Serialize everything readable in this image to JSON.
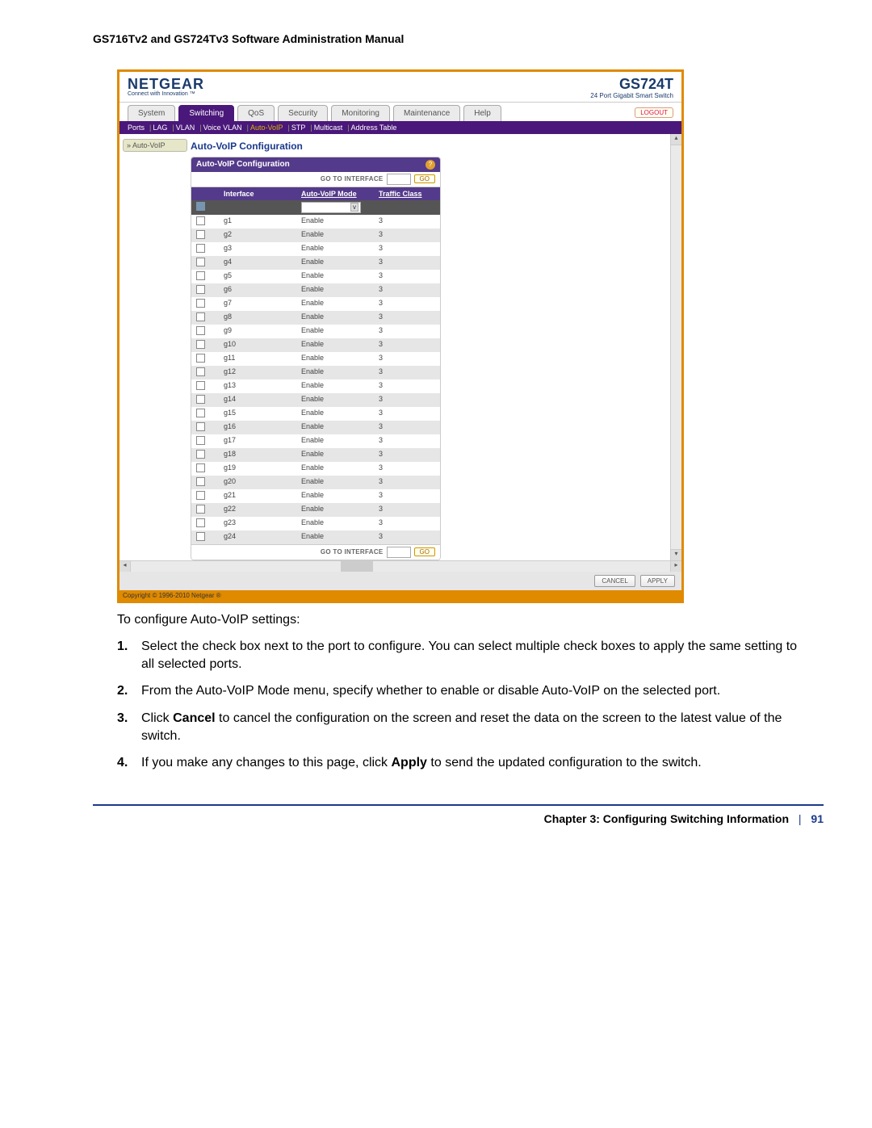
{
  "doc_title": "GS716Tv2 and GS724Tv3 Software Administration Manual",
  "header": {
    "logo": "NETGEAR",
    "logo_sub": "Connect with Innovation ™",
    "model": "GS724T",
    "model_sub": "24 Port Gigabit Smart Switch"
  },
  "tabs": {
    "items": [
      "System",
      "Switching",
      "QoS",
      "Security",
      "Monitoring",
      "Maintenance",
      "Help"
    ],
    "active_index": 1,
    "logout": "LOGOUT"
  },
  "subtabs": {
    "items": [
      "Ports",
      "LAG",
      "VLAN",
      "Voice VLAN",
      "Auto-VoIP",
      "STP",
      "Multicast",
      "Address Table"
    ],
    "active_index": 4
  },
  "side_button": "» Auto-VoIP",
  "section_title": "Auto-VoIP Configuration",
  "panel": {
    "title": "Auto-VoIP Configuration",
    "goto_label": "GO TO INTERFACE",
    "go_btn": "GO",
    "columns": {
      "interface": "Interface",
      "mode": "Auto-VoIP Mode",
      "tc": "Traffic Class"
    },
    "rows": [
      {
        "if": "g1",
        "mode": "Enable",
        "tc": "3"
      },
      {
        "if": "g2",
        "mode": "Enable",
        "tc": "3"
      },
      {
        "if": "g3",
        "mode": "Enable",
        "tc": "3"
      },
      {
        "if": "g4",
        "mode": "Enable",
        "tc": "3"
      },
      {
        "if": "g5",
        "mode": "Enable",
        "tc": "3"
      },
      {
        "if": "g6",
        "mode": "Enable",
        "tc": "3"
      },
      {
        "if": "g7",
        "mode": "Enable",
        "tc": "3"
      },
      {
        "if": "g8",
        "mode": "Enable",
        "tc": "3"
      },
      {
        "if": "g9",
        "mode": "Enable",
        "tc": "3"
      },
      {
        "if": "g10",
        "mode": "Enable",
        "tc": "3"
      },
      {
        "if": "g11",
        "mode": "Enable",
        "tc": "3"
      },
      {
        "if": "g12",
        "mode": "Enable",
        "tc": "3"
      },
      {
        "if": "g13",
        "mode": "Enable",
        "tc": "3"
      },
      {
        "if": "g14",
        "mode": "Enable",
        "tc": "3"
      },
      {
        "if": "g15",
        "mode": "Enable",
        "tc": "3"
      },
      {
        "if": "g16",
        "mode": "Enable",
        "tc": "3"
      },
      {
        "if": "g17",
        "mode": "Enable",
        "tc": "3"
      },
      {
        "if": "g18",
        "mode": "Enable",
        "tc": "3"
      },
      {
        "if": "g19",
        "mode": "Enable",
        "tc": "3"
      },
      {
        "if": "g20",
        "mode": "Enable",
        "tc": "3"
      },
      {
        "if": "g21",
        "mode": "Enable",
        "tc": "3"
      },
      {
        "if": "g22",
        "mode": "Enable",
        "tc": "3"
      },
      {
        "if": "g23",
        "mode": "Enable",
        "tc": "3"
      },
      {
        "if": "g24",
        "mode": "Enable",
        "tc": "3"
      }
    ]
  },
  "actions": {
    "cancel": "CANCEL",
    "apply": "APPLY"
  },
  "copyright": "Copyright © 1996-2010 Netgear ®",
  "instructions": {
    "intro": "To configure Auto-VoIP settings:",
    "steps": [
      "Select the check box next to the port to configure. You can select multiple check boxes to apply the same setting to all selected ports.",
      "From the Auto-VoIP Mode menu, specify whether to enable or disable Auto-VoIP on the selected port.",
      "Click Cancel to cancel the configuration on the screen and reset the data on the screen to the latest value of the switch.",
      "If you make any changes to this page, click Apply to send the updated configuration to the switch."
    ],
    "bold_words": {
      "2": "Cancel",
      "3": "Apply"
    }
  },
  "footer": {
    "chapter": "Chapter 3:  Configuring Switching Information",
    "page": "91"
  }
}
